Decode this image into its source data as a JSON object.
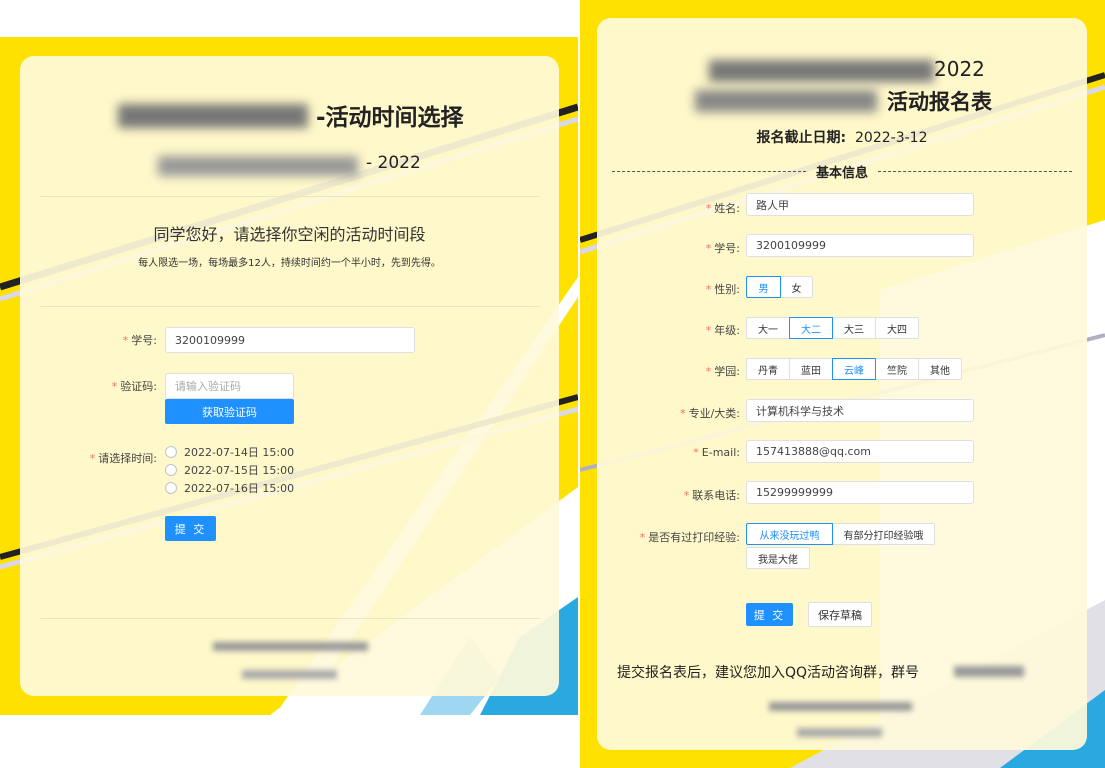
{
  "left": {
    "title_suffix": "-活动时间选择",
    "subtitle_suffix": "- 2022",
    "greeting": "同学您好，请选择你空闲的活动时间段",
    "notice": "每人限选一场，每场最多12人，持续时间约一个半小时，先到先得。",
    "form": {
      "student_id_label": "学号:",
      "student_id_value": "3200109999",
      "captcha_label": "验证码:",
      "captcha_placeholder": "请输入验证码",
      "get_captcha_button": "获取验证码",
      "time_label": "请选择时间:",
      "time_options": [
        "2022-07-14日 15:00",
        "2022-07-15日 15:00",
        "2022-07-16日 15:00"
      ],
      "submit_button": "提 交"
    }
  },
  "right": {
    "title_year": "2022",
    "title_suffix": "活动报名表",
    "deadline_label": "报名截止日期:",
    "deadline_value": "2022-3-12",
    "section_title": "基本信息",
    "form": {
      "name_label": "姓名:",
      "name_value": "路人甲",
      "student_id_label": "学号:",
      "student_id_value": "3200109999",
      "gender_label": "性别:",
      "gender_options": [
        "男",
        "女"
      ],
      "grade_label": "年级:",
      "grade_options": [
        "大一",
        "大二",
        "大三",
        "大四"
      ],
      "campus_label": "学园:",
      "campus_options": [
        "丹青",
        "蓝田",
        "云峰",
        "竺院",
        "其他"
      ],
      "major_label": "专业/大类:",
      "major_value": "计算机科学与技术",
      "email_label": "E-mail:",
      "email_value": "157413888@qq.com",
      "phone_label": "联系电话:",
      "phone_value": "15299999999",
      "experience_label": "是否有过打印经验:",
      "experience_options": [
        "从来没玩过鸭",
        "有部分打印经验哦",
        "我是大佬"
      ],
      "submit_button": "提 交",
      "draft_button": "保存草稿"
    },
    "footer_text": "提交报名表后，建议您加入QQ活动咨询群，群号"
  },
  "colors": {
    "accent": "#1e90ff",
    "background": "#ffe100",
    "required": "#f56c6c"
  }
}
